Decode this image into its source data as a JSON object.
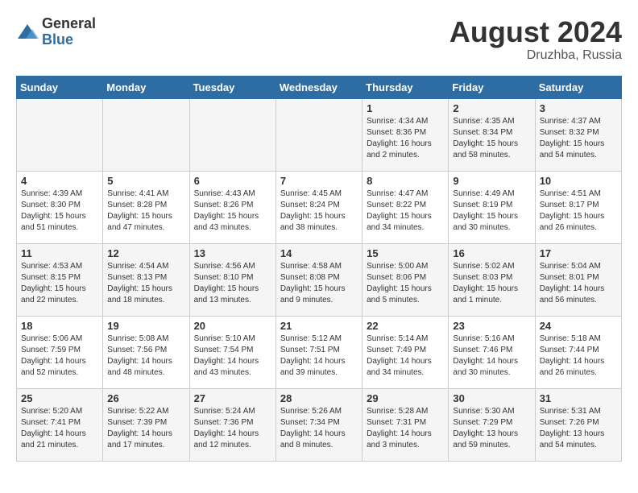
{
  "logo": {
    "general": "General",
    "blue": "Blue"
  },
  "title": {
    "month_year": "August 2024",
    "location": "Druzhba, Russia"
  },
  "headers": [
    "Sunday",
    "Monday",
    "Tuesday",
    "Wednesday",
    "Thursday",
    "Friday",
    "Saturday"
  ],
  "weeks": [
    [
      {
        "day": "",
        "info": ""
      },
      {
        "day": "",
        "info": ""
      },
      {
        "day": "",
        "info": ""
      },
      {
        "day": "",
        "info": ""
      },
      {
        "day": "1",
        "info": "Sunrise: 4:34 AM\nSunset: 8:36 PM\nDaylight: 16 hours\nand 2 minutes."
      },
      {
        "day": "2",
        "info": "Sunrise: 4:35 AM\nSunset: 8:34 PM\nDaylight: 15 hours\nand 58 minutes."
      },
      {
        "day": "3",
        "info": "Sunrise: 4:37 AM\nSunset: 8:32 PM\nDaylight: 15 hours\nand 54 minutes."
      }
    ],
    [
      {
        "day": "4",
        "info": "Sunrise: 4:39 AM\nSunset: 8:30 PM\nDaylight: 15 hours\nand 51 minutes."
      },
      {
        "day": "5",
        "info": "Sunrise: 4:41 AM\nSunset: 8:28 PM\nDaylight: 15 hours\nand 47 minutes."
      },
      {
        "day": "6",
        "info": "Sunrise: 4:43 AM\nSunset: 8:26 PM\nDaylight: 15 hours\nand 43 minutes."
      },
      {
        "day": "7",
        "info": "Sunrise: 4:45 AM\nSunset: 8:24 PM\nDaylight: 15 hours\nand 38 minutes."
      },
      {
        "day": "8",
        "info": "Sunrise: 4:47 AM\nSunset: 8:22 PM\nDaylight: 15 hours\nand 34 minutes."
      },
      {
        "day": "9",
        "info": "Sunrise: 4:49 AM\nSunset: 8:19 PM\nDaylight: 15 hours\nand 30 minutes."
      },
      {
        "day": "10",
        "info": "Sunrise: 4:51 AM\nSunset: 8:17 PM\nDaylight: 15 hours\nand 26 minutes."
      }
    ],
    [
      {
        "day": "11",
        "info": "Sunrise: 4:53 AM\nSunset: 8:15 PM\nDaylight: 15 hours\nand 22 minutes."
      },
      {
        "day": "12",
        "info": "Sunrise: 4:54 AM\nSunset: 8:13 PM\nDaylight: 15 hours\nand 18 minutes."
      },
      {
        "day": "13",
        "info": "Sunrise: 4:56 AM\nSunset: 8:10 PM\nDaylight: 15 hours\nand 13 minutes."
      },
      {
        "day": "14",
        "info": "Sunrise: 4:58 AM\nSunset: 8:08 PM\nDaylight: 15 hours\nand 9 minutes."
      },
      {
        "day": "15",
        "info": "Sunrise: 5:00 AM\nSunset: 8:06 PM\nDaylight: 15 hours\nand 5 minutes."
      },
      {
        "day": "16",
        "info": "Sunrise: 5:02 AM\nSunset: 8:03 PM\nDaylight: 15 hours\nand 1 minute."
      },
      {
        "day": "17",
        "info": "Sunrise: 5:04 AM\nSunset: 8:01 PM\nDaylight: 14 hours\nand 56 minutes."
      }
    ],
    [
      {
        "day": "18",
        "info": "Sunrise: 5:06 AM\nSunset: 7:59 PM\nDaylight: 14 hours\nand 52 minutes."
      },
      {
        "day": "19",
        "info": "Sunrise: 5:08 AM\nSunset: 7:56 PM\nDaylight: 14 hours\nand 48 minutes."
      },
      {
        "day": "20",
        "info": "Sunrise: 5:10 AM\nSunset: 7:54 PM\nDaylight: 14 hours\nand 43 minutes."
      },
      {
        "day": "21",
        "info": "Sunrise: 5:12 AM\nSunset: 7:51 PM\nDaylight: 14 hours\nand 39 minutes."
      },
      {
        "day": "22",
        "info": "Sunrise: 5:14 AM\nSunset: 7:49 PM\nDaylight: 14 hours\nand 34 minutes."
      },
      {
        "day": "23",
        "info": "Sunrise: 5:16 AM\nSunset: 7:46 PM\nDaylight: 14 hours\nand 30 minutes."
      },
      {
        "day": "24",
        "info": "Sunrise: 5:18 AM\nSunset: 7:44 PM\nDaylight: 14 hours\nand 26 minutes."
      }
    ],
    [
      {
        "day": "25",
        "info": "Sunrise: 5:20 AM\nSunset: 7:41 PM\nDaylight: 14 hours\nand 21 minutes."
      },
      {
        "day": "26",
        "info": "Sunrise: 5:22 AM\nSunset: 7:39 PM\nDaylight: 14 hours\nand 17 minutes."
      },
      {
        "day": "27",
        "info": "Sunrise: 5:24 AM\nSunset: 7:36 PM\nDaylight: 14 hours\nand 12 minutes."
      },
      {
        "day": "28",
        "info": "Sunrise: 5:26 AM\nSunset: 7:34 PM\nDaylight: 14 hours\nand 8 minutes."
      },
      {
        "day": "29",
        "info": "Sunrise: 5:28 AM\nSunset: 7:31 PM\nDaylight: 14 hours\nand 3 minutes."
      },
      {
        "day": "30",
        "info": "Sunrise: 5:30 AM\nSunset: 7:29 PM\nDaylight: 13 hours\nand 59 minutes."
      },
      {
        "day": "31",
        "info": "Sunrise: 5:31 AM\nSunset: 7:26 PM\nDaylight: 13 hours\nand 54 minutes."
      }
    ]
  ]
}
